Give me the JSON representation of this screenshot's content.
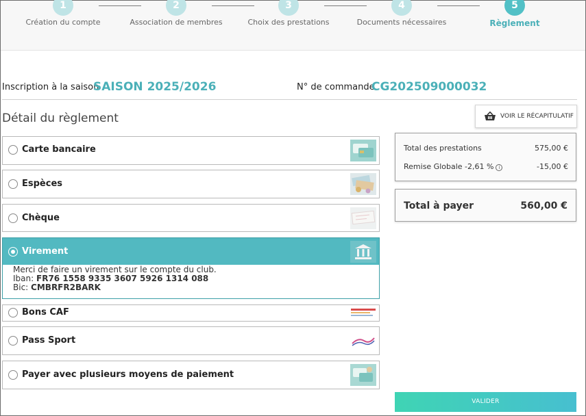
{
  "stepper": {
    "steps": [
      {
        "number": "1",
        "label": "Création du compte"
      },
      {
        "number": "2",
        "label": "Association de membres"
      },
      {
        "number": "3",
        "label": "Choix des prestations"
      },
      {
        "number": "4",
        "label": "Documents nécessaires"
      },
      {
        "number": "5",
        "label": "Règlement"
      }
    ],
    "active_step": 5
  },
  "header": {
    "season_label": "Inscription à la saison",
    "season_value": "SAISON 2025/2026",
    "order_label": "N° de commande",
    "order_value": "CG202509000032"
  },
  "section_title": "Détail du règlement",
  "recap_button": {
    "label": "VOIR LE RÉCAPITULATIF",
    "icon": "basket-icon"
  },
  "payment_options": [
    {
      "label": "Carte bancaire",
      "selected": false
    },
    {
      "label": "Espèces",
      "selected": false
    },
    {
      "label": "Chèque",
      "selected": false
    },
    {
      "label": "Virement",
      "selected": true
    },
    {
      "label": "Bons CAF",
      "selected": false
    },
    {
      "label": "Pass Sport",
      "selected": false
    },
    {
      "label": "Payer avec plusieurs moyens de paiement",
      "selected": false
    }
  ],
  "virement_details": {
    "message": "Merci de faire un virement sur le compte du club.",
    "iban_label": "Iban:",
    "iban_value": "FR76 1558 9335 3607 5926 1314 088",
    "bic_label": "Bic:",
    "bic_value": "CMBRFR2BARK"
  },
  "totals": {
    "prestations_label": "Total des prestations",
    "prestations_value": "575,00 €",
    "remise_label": "Remise Globale -2,61  %",
    "remise_value": "-15,00 €",
    "total_label": "Total à payer",
    "total_value": "560,00 €"
  },
  "valider_label": "VALIDER",
  "colors": {
    "accent": "#52b9c1",
    "accent_text": "#4bb0b8",
    "button_gradient_start": "#3fd4b4",
    "button_gradient_end": "#47bfd0"
  }
}
